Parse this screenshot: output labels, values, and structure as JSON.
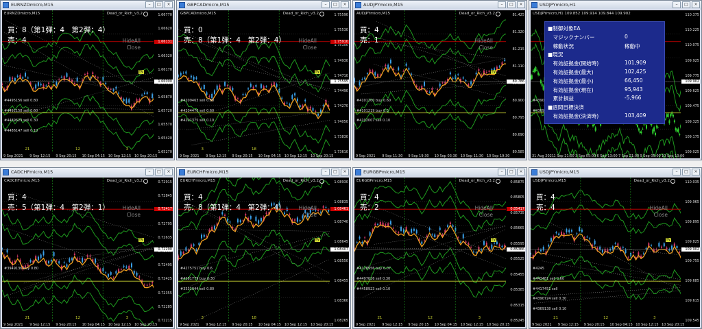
{
  "common": {
    "ea_name": "Dead_or_Rich_v3.2",
    "hide_label": "HideAll",
    "close_label": "Close",
    "tv_label": "TV"
  },
  "panels": [
    {
      "title": "EURNZDmicro,M15",
      "symbol": "EURNZDmicro,M15",
      "overlay": [
        "買：8（第1弾：4　第2弾：4）",
        "売：4"
      ],
      "prices": [
        "1.66770",
        "1.66620",
        "1.66470",
        "1.66320",
        "1.66170",
        "1.66020",
        "1.65870",
        "1.65720",
        "1.65570",
        "1.65420",
        "1.65270"
      ],
      "time_labels": [
        "9 Sep 2021",
        "9 Sep 12:15",
        "9 Sep 20:15",
        "10 Sep 04:15",
        "10 Sep 12:15",
        "10 Sep 20:15"
      ],
      "segment_labels": [
        "21",
        "12",
        "3"
      ],
      "position_lines": [
        "#4495156 sell 0.80",
        "#4492158 sell 0.60",
        "#4489629 sell 0.30",
        "#4486147 sell 0.10"
      ],
      "price_box": {
        "value": "1.66000",
        "color": "#ffffff",
        "text": "#000000"
      },
      "bid": {
        "value": "1.66131",
        "color": "#cc0000"
      }
    },
    {
      "title": "GBPCADmicro,M15",
      "symbol": "GBPCADmicro,M15",
      "overlay": [
        "買：0",
        "売：8（第1弾：4　第2弾：4）"
      ],
      "prices": [
        "1.75590",
        "1.75530",
        "1.75150",
        "1.74930",
        "1.74710",
        "1.74490",
        "1.74270",
        "1.74050",
        "1.73830",
        "1.73610"
      ],
      "time_labels": [
        "9 Sep 2021",
        "9 Sep 12:15",
        "9 Sep 20:15",
        "10 Sep 04:15",
        "10 Sep 12:15",
        "10 Sep 20:15"
      ],
      "segment_labels": [
        "3",
        "18"
      ],
      "position_lines": [
        "#4209463 sell 0.80",
        "#4204470 sell 0.60",
        "#4201375 sell 0.10"
      ],
      "price_box": {
        "value": "1.75595",
        "color": "#ffffff",
        "text": "#000000"
      },
      "bid": {
        "value": "1.75910",
        "color": "#cc0000"
      }
    },
    {
      "title": "AUDJPYmicro,M15",
      "symbol": "AUDJPYmicro,M15",
      "overlay": [
        "買：4",
        "売：1"
      ],
      "prices": [
        "81.425",
        "81.320",
        "81.215",
        "81.110",
        "81.005",
        "80.900",
        "80.795",
        "80.690",
        "80.585"
      ],
      "time_labels": [
        "9 Sep 2021",
        "9 Sep 11:30",
        "9 Sep 19:30",
        "10 Sep 03:30",
        "10 Sep 11:30",
        "10 Sep 19:30"
      ],
      "segment_labels": [],
      "position_lines": [
        "#4101200 buy 0.60",
        "#4101219 buy 0.3",
        "#4102007 sell 0.10"
      ],
      "price_box": {
        "value": "80.786",
        "color": "#ffffff",
        "text": "#000000"
      },
      "bid": {
        "value": "",
        "color": "#cc0000"
      }
    },
    {
      "title": "USDJPYmicro,H1",
      "symbol": "USDJPYmicro,H1  109.852  109.914  109.844  109.902",
      "overlay": [],
      "prices": [
        "110.375",
        "110.225",
        "110.075",
        "109.925",
        "109.775",
        "109.625",
        "109.475",
        "109.325",
        "109.175",
        "109.025"
      ],
      "time_labels": [
        "31 Aug 2021",
        "1 Sep 21:00",
        "3 Sep 05:00",
        "6 Sep 13:00",
        "7 Sep 21:00",
        "9 Sep 05:00",
        "10 Sep 13:00"
      ],
      "segment_labels": [],
      "position_lines": [
        "#4390724 sell 0.30",
        "#4369138 sell 0.10"
      ],
      "price_box": {
        "value": "109.902",
        "color": "#ffffff",
        "text": "#000000"
      },
      "bid": {
        "value": "",
        "color": "#cc0000"
      },
      "ea_panel": {
        "rows": [
          {
            "label": "■制御対象EA",
            "value": ""
          },
          {
            "label": "　マジックナンバー",
            "value": "0"
          },
          {
            "label": "　稼動状況",
            "value": "稼動中"
          },
          {
            "label": "■現況",
            "value": ""
          },
          {
            "label": "　有効証拠金(開始時)",
            "value": "101,909"
          },
          {
            "label": "　有効証拠金(最大)",
            "value": "102,425"
          },
          {
            "label": "　有効証拠金(最小)",
            "value": "66,450"
          },
          {
            "label": "　有効証拠金(現在)",
            "value": "95,943"
          },
          {
            "label": "　累計損益",
            "value": "-5,966"
          },
          {
            "label": "■週間目標決済",
            "value": ""
          },
          {
            "label": "　有効証拠金(決済時)",
            "value": "103,409"
          }
        ]
      }
    },
    {
      "title": "CADCHFmicro,M15",
      "symbol": "CADCHFmicro,M15",
      "overlay": [
        "買：4",
        "売：5（第1弾：4　第2弾：1）"
      ],
      "prices": [
        "0.72915",
        "0.72845",
        "0.72775",
        "0.72705",
        "0.72635",
        "0.72565",
        "0.72495",
        "0.72425",
        "0.72355",
        "0.72285",
        "0.72215"
      ],
      "time_labels": [
        "9 Sep 2021",
        "9 Sep 12:15",
        "9 Sep 20:15",
        "10 Sep 04:15",
        "10 Sep 12:15",
        "10 Sep 20:15"
      ],
      "segment_labels": [
        "21",
        "12",
        "3"
      ],
      "position_lines": [
        "#3949136 buy 0.80"
      ],
      "price_box": {
        "value": "0.72290",
        "color": "#ffffff",
        "text": "#000000"
      },
      "bid": {
        "value": "0.72417",
        "color": "#cc0000"
      }
    },
    {
      "title": "EURCHFmicro,M15",
      "symbol": "EURCHFmicro,M15",
      "overlay": [
        "買：4",
        "売：8（第1弾：4　第2弾：4）"
      ],
      "prices": [
        "1.08930",
        "1.08835",
        "1.08740",
        "1.08645",
        "1.08550",
        "1.08455",
        "1.08360",
        "1.08265"
      ],
      "time_labels": [
        "9 Sep 2021",
        "9 Sep 12:15",
        "9 Sep 20:15",
        "10 Sep 04:15",
        "10 Sep 12:15",
        "10 Sep 20:15"
      ],
      "segment_labels": [
        "3",
        "18"
      ],
      "position_lines": [
        "#4275751 buy 0.6",
        "#4281779 buy 0.30",
        "#3531044 sell 0.80"
      ],
      "price_box": {
        "value": "1.08407",
        "color": "#ffffff",
        "text": "#000000"
      },
      "bid": {
        "value": "1.08461",
        "color": "#cc0000"
      }
    },
    {
      "title": "EURGBPmicro,M15",
      "symbol": "EURGBPmicro,M15",
      "overlay": [
        "買：4",
        "売：2"
      ],
      "prices": [
        "0.85875",
        "0.85805",
        "0.85735",
        "0.85665",
        "0.85595",
        "0.85525",
        "0.85455",
        "0.85385",
        "0.85315",
        "0.85245"
      ],
      "time_labels": [
        "9 Sep 2021",
        "9 Sep 12:15",
        "9 Sep 20:15",
        "10 Sep 04:15",
        "10 Sep 12:15",
        "10 Sep 20:15"
      ],
      "segment_labels": [
        "21",
        "12",
        "3"
      ],
      "position_lines": [
        "#4128956 buy 0.07",
        "#4497026 sell 0.30",
        "#4458923 sell 0.10"
      ],
      "price_box": {
        "value": "0.85366",
        "color": "#ffffff",
        "text": "#000000"
      },
      "bid": {
        "value": "0.85417",
        "color": "#cc0000"
      }
    },
    {
      "title": "USDJPYmicro,M15",
      "symbol": "USDJPYmicro,M15",
      "overlay": [
        "買：4",
        "売：4"
      ],
      "prices": [
        "110.035",
        "109.965",
        "109.895",
        "109.825",
        "109.755",
        "109.685",
        "109.615",
        "109.545"
      ],
      "time_labels": [
        "9 Sep 2021",
        "9 Sep 12:15",
        "9 Sep 20:15",
        "10 Sep 04:15",
        "10 Sep 12:15",
        "10 Sep 20:15"
      ],
      "segment_labels": [
        "21",
        "12",
        "3"
      ],
      "position_lines": [
        "#4245",
        "#443481 sell 0.60",
        "#4417451 sell",
        "#4390724 sell 0.30",
        "#4369138 sell 0.10"
      ],
      "price_box": {
        "value": "109.902",
        "color": "#ffffff",
        "text": "#000000"
      },
      "bid": {
        "value": "",
        "color": "#cc0000"
      }
    }
  ]
}
